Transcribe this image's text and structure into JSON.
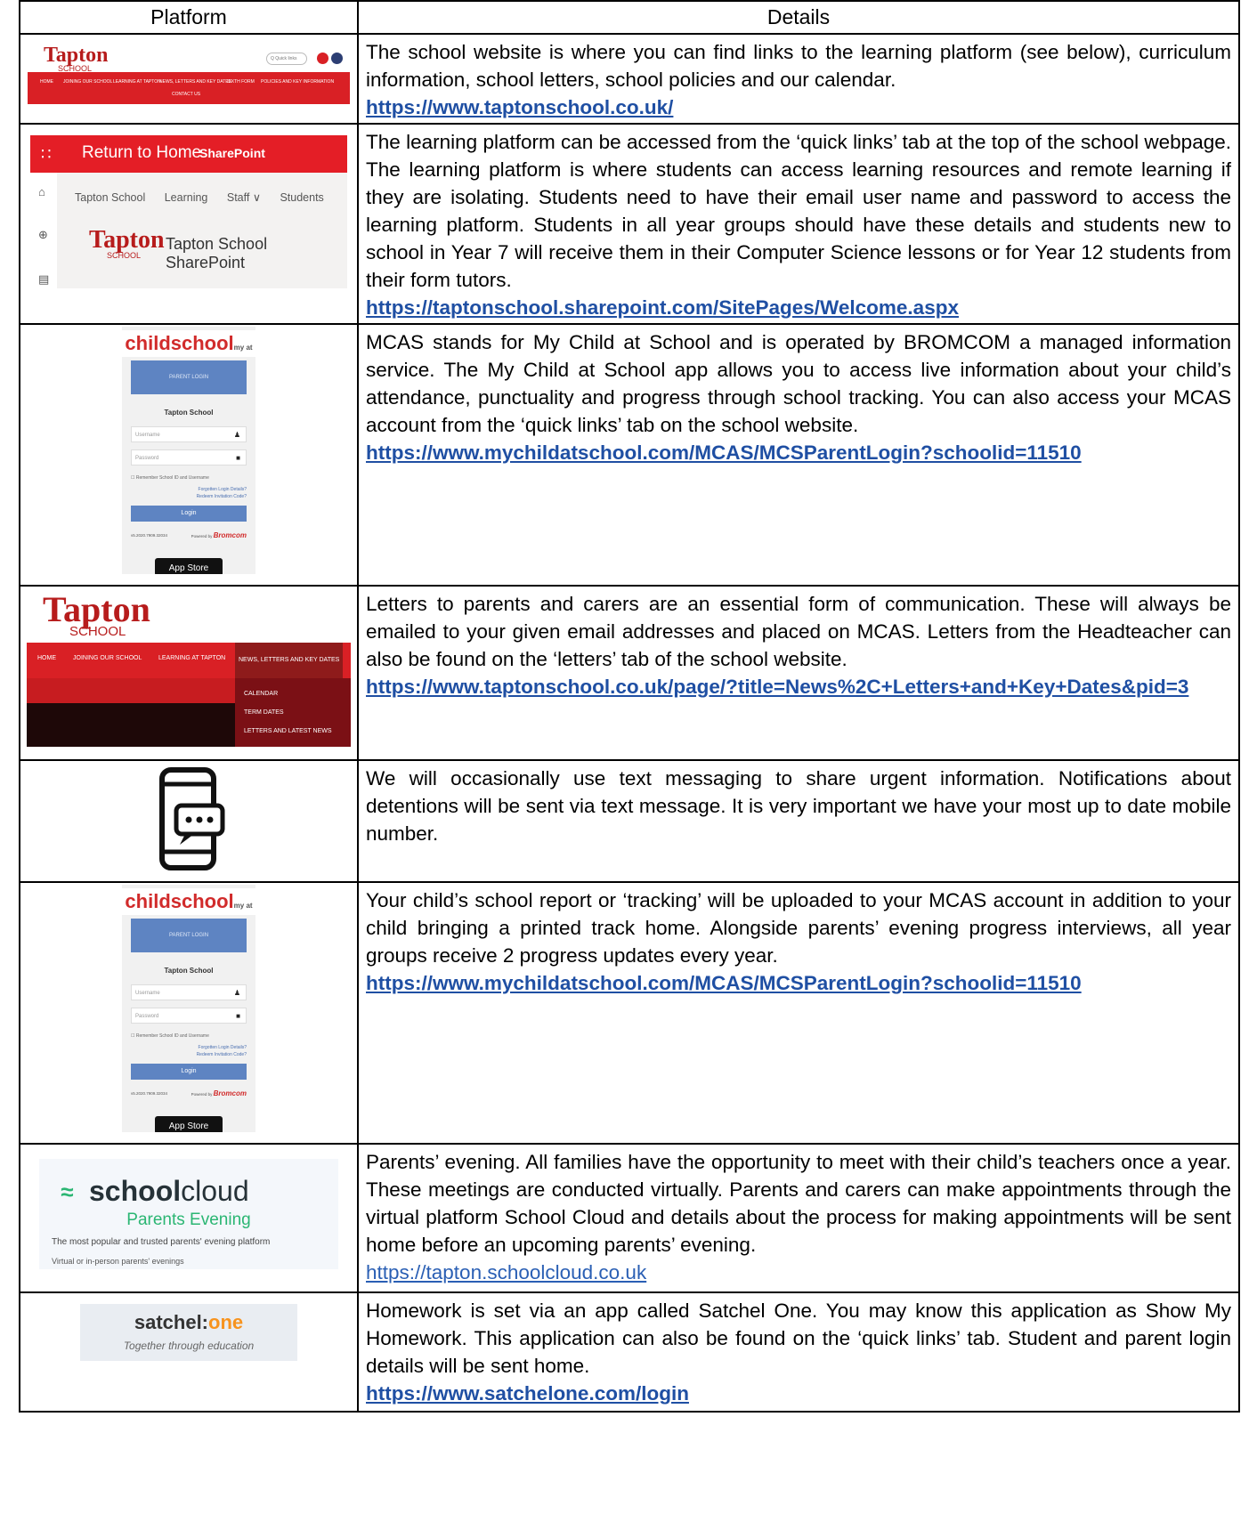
{
  "headers": {
    "platform": "Platform",
    "details": "Details"
  },
  "rows": [
    {
      "text": "The school website is where you can find links to the learning platform (see below), curriculum information, school letters, school policies and our calendar.",
      "link": "https://www.taptonschool.co.uk/"
    },
    {
      "text": "The learning platform can be accessed from the ‘quick links’ tab at the top of the school webpage.  The learning platform is where students can access learning resources and remote learning if they are isolating.  Students need to have their email user name and password to access the learning platform.  Students in all year groups should have these details and students new to school in Year 7 will receive them in their Computer Science lessons or for Year 12 students from their form tutors.",
      "link": "https://taptonschool.sharepoint.com/SitePages/Welcome.aspx"
    },
    {
      "text": "MCAS stands for My Child at School and is operated by BROMCOM a managed information service.  The My Child at School app allows you to access live information about your child’s attendance, punctuality and progress through school tracking.  You can also access your MCAS account from the ‘quick links’ tab on the school website.",
      "link": "https://www.mychildatschool.com/MCAS/MCSParentLogin?schoolid=11510"
    },
    {
      "text": "Letters to parents and carers are an essential form of communication.  These will always be emailed to your given email addresses and placed on MCAS.  Letters from the Headteacher can also be found on the ‘letters’ tab of the school website.",
      "link": "https://www.taptonschool.co.uk/page/?title=News%2C+Letters+and+Key+Dates&pid=3"
    },
    {
      "text": "We will occasionally use text messaging to share urgent information. Notifications about detentions will be sent via text message.  It is very important we have your most up to date mobile number.",
      "link": ""
    },
    {
      "text": "Your child’s school report or ‘tracking’ will be uploaded to your MCAS account in addition to your child bringing a printed track home.  Alongside parents’ evening progress interviews, all year groups receive 2 progress updates every year.",
      "link": "https://www.mychildatschool.com/MCAS/MCSParentLogin?schoolid=11510"
    },
    {
      "text": "Parents’ evening.  All families have the opportunity to meet with their child’s teachers once a year.   These meetings are conducted virtually.   Parents and carers can make appointments through the virtual platform School Cloud and details about the process for making appointments will be sent home before an upcoming parents’ evening.",
      "link": "https://tapton.schoolcloud.co.uk"
    },
    {
      "text": "Homework is set via an app called Satchel One.  You may know this application as Show My Homework.  This application can also be found on the ‘quick links’ tab.  Student and parent login details will be sent home.",
      "link": "https://www.satchelone.com/login"
    }
  ],
  "thumbs": {
    "tapton_site": {
      "logo": "Tapton",
      "logo_sub": "SCHOOL",
      "search": "Q Quick links",
      "nav": [
        "HOME",
        "JOINING OUR SCHOOL",
        "LEARNING AT TAPTON",
        "NEWS, LETTERS AND KEY DATES",
        "SIXTH FORM",
        "POLICIES AND KEY INFORMATION",
        "CONTACT US"
      ]
    },
    "sharepoint": {
      "waffle": "∷",
      "return": "Return to Home",
      "brand": "SharePoint",
      "nav": [
        "Tapton School",
        "Learning",
        "Staff ∨",
        "Students"
      ],
      "logo": "Tapton",
      "logo_sub": "SCHOOL",
      "title": "Tapton School SharePoint"
    },
    "mcas": {
      "brand": "childschool",
      "brand_sup": "my at",
      "parent_login": "PARENT LOGIN",
      "school": "Tapton School",
      "username": "Username",
      "password": "Password",
      "remember": "Remember School ID and Username",
      "forgotten": "Forgotten Login Details?",
      "redeem": "Redeem Invitation Code?",
      "login": "Login",
      "version": "v5.2020.7909.32034",
      "powered": "Powered by",
      "bromcom": "Bromcom",
      "appstore": "App Store"
    },
    "letters": {
      "logo": "Tapton",
      "logo_sub": "SCHOOL",
      "nav": [
        "HOME",
        "JOINING OUR SCHOOL",
        "LEARNING AT TAPTON",
        "NEWS, LETTERS AND KEY DATES"
      ],
      "menu": [
        "CALENDAR",
        "TERM DATES",
        "LETTERS AND LATEST NEWS"
      ]
    },
    "schoolcloud": {
      "mark": "≈",
      "name_bold": "school",
      "name_light": "cloud",
      "pe": "Parents Evening",
      "tag": "The most popular and trusted parents' evening platform",
      "sub": "Virtual or in-person parents' evenings"
    },
    "satchel": {
      "name": "satchel:",
      "name_accent": "one",
      "tag": "Together through education"
    }
  },
  "colors": {
    "link": "#1f4fa3",
    "tapton_red": "#d92025",
    "mcas_blue": "#5e84c2",
    "schoolcloud_green": "#2bb673"
  }
}
